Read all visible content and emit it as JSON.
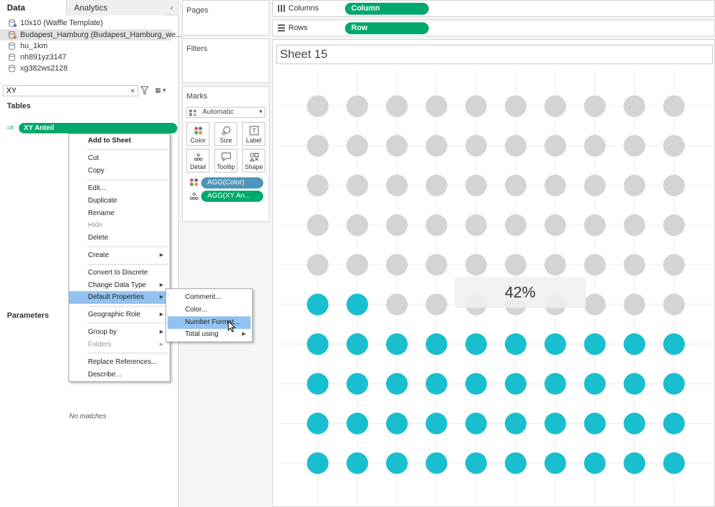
{
  "tabs": {
    "data": "Data",
    "analytics": "Analytics"
  },
  "datasources": [
    {
      "name": "10x10 (Waffle Template)"
    },
    {
      "name": "Budapest_Hamburg (Budapest_Hamburg_we..."
    },
    {
      "name": "hu_1km"
    },
    {
      "name": "nh891yz3147"
    },
    {
      "name": "xg382ws2128"
    }
  ],
  "search": {
    "value": "XY"
  },
  "sections": {
    "tables": "Tables",
    "parameters": "Parameters"
  },
  "field": {
    "type_glyph": "=#",
    "name": "XY Anteil"
  },
  "no_matches": "No matches",
  "context_menu": {
    "add_to_sheet": "Add to Sheet",
    "cut": "Cut",
    "copy": "Copy",
    "edit": "Edit...",
    "duplicate": "Duplicate",
    "rename": "Rename",
    "hide": "Hide",
    "delete": "Delete",
    "create": "Create",
    "convert_to_discrete": "Convert to Discrete",
    "change_data_type": "Change Data Type",
    "default_properties": "Default Properties",
    "geographic_role": "Geographic Role",
    "group_by": "Group by",
    "folders": "Folders",
    "replace_references": "Replace References...",
    "describe": "Describe..."
  },
  "submenu": {
    "comment": "Comment...",
    "color": "Color...",
    "number_format": "Number Format...",
    "total_using": "Total using"
  },
  "cards": {
    "pages": "Pages",
    "filters": "Filters",
    "marks": "Marks"
  },
  "marks": {
    "type": "Automatic",
    "buttons": {
      "color": "Color",
      "size": "Size",
      "label": "Label",
      "detail": "Detail",
      "tooltip": "Tooltip",
      "shape": "Shape"
    },
    "pills": [
      {
        "label": "AGG(Color)"
      },
      {
        "label": "AGG(XY An..."
      }
    ]
  },
  "shelves": {
    "columns": {
      "label": "Columns",
      "pill": "Column"
    },
    "rows": {
      "label": "Rows",
      "pill": "Row"
    }
  },
  "sheet": {
    "title": "Sheet 15"
  },
  "colors": {
    "green_pill": "#00a86b",
    "blue_pill": "#4e95b9",
    "filled": "#19bfcf",
    "empty": "#d4d4d4",
    "highlight": "#92c2ef"
  },
  "chart_data": {
    "type": "scatter",
    "grid_columns": 10,
    "grid_rows": 10,
    "percent_filled": 42,
    "label": "42%"
  }
}
